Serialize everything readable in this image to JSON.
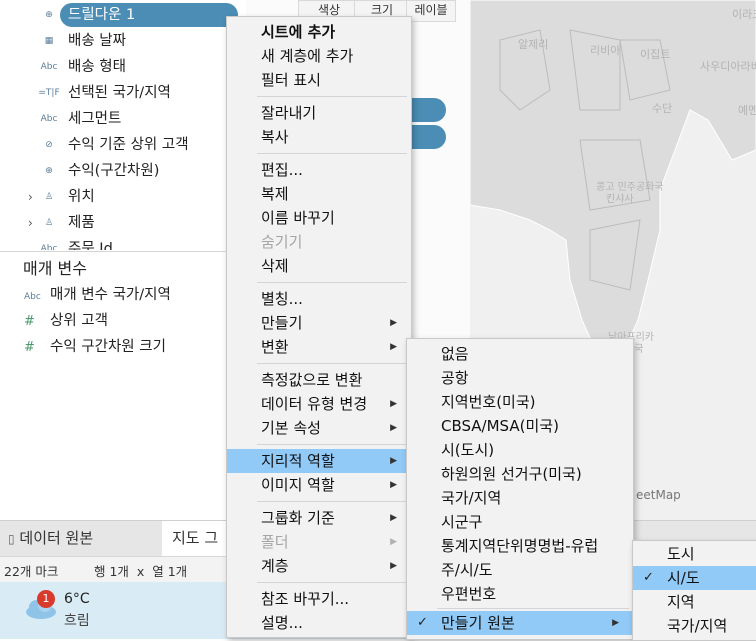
{
  "data_pane": {
    "fields": [
      {
        "icon": "⊕",
        "icon_name": "globe-icon",
        "label": "드릴다운 1",
        "selected": true
      },
      {
        "icon": "▦",
        "icon_name": "calendar-icon",
        "label": "배송 날짜"
      },
      {
        "icon": "Abc",
        "icon_name": "string-icon",
        "label": "배송 형태"
      },
      {
        "icon": "=T|F",
        "icon_name": "calculated-field-icon",
        "label": "선택된 국가/지역"
      },
      {
        "icon": "Abc",
        "icon_name": "string-icon",
        "label": "세그먼트"
      },
      {
        "icon": "⊘",
        "icon_name": "set-icon",
        "label": "수익 기준 상위 고객"
      },
      {
        "icon": "⊕",
        "icon_name": "bins-icon",
        "label": "수익(구간차원)"
      },
      {
        "icon": "♙",
        "icon_name": "hierarchy-icon",
        "label": "위치",
        "expandable": true
      },
      {
        "icon": "♙",
        "icon_name": "hierarchy-icon",
        "label": "제품",
        "expandable": true
      },
      {
        "icon": "Abc",
        "icon_name": "string-icon",
        "label": "주문 Id"
      }
    ],
    "parameters_title": "매개 변수",
    "parameters": [
      {
        "icon": "Abc",
        "icon_name": "string-icon",
        "label": "매개 변수 국가/지역"
      },
      {
        "icon": "#",
        "icon_name": "number-icon",
        "label": "상위 고객"
      },
      {
        "icon": "#",
        "icon_name": "number-icon",
        "label": "수익 구간차원 크기"
      }
    ]
  },
  "marks_card": {
    "buttons": [
      "색상",
      "크기",
      "레이블"
    ]
  },
  "map": {
    "labels": [
      "이라크",
      "알제리",
      "리비아",
      "이집트",
      "사우디아라비아",
      "수단",
      "예멘",
      "콩고 민주공화국",
      "킨샤사",
      "남아프리카",
      "공화국"
    ],
    "attribution": "eetMap"
  },
  "tabs": {
    "data_source": "데이터 원본",
    "sheet": "지도 그"
  },
  "status": {
    "marks": "22개 마크",
    "rows_cols": "행 1개  x  열 1개"
  },
  "taskbar": {
    "weather_badge": "1",
    "temperature": "6°C",
    "condition": "흐림"
  },
  "context_menu": {
    "items": [
      {
        "label": "시트에 추가",
        "bold": true
      },
      {
        "label": "새 계층에 추가"
      },
      {
        "label": "필터 표시"
      },
      {
        "separator": true
      },
      {
        "label": "잘라내기"
      },
      {
        "label": "복사"
      },
      {
        "separator": true
      },
      {
        "label": "편집..."
      },
      {
        "label": "복제"
      },
      {
        "label": "이름 바꾸기"
      },
      {
        "label": "숨기기",
        "disabled": true
      },
      {
        "label": "삭제"
      },
      {
        "separator": true
      },
      {
        "label": "별칭..."
      },
      {
        "label": "만들기",
        "submenu": true
      },
      {
        "label": "변환",
        "submenu": true
      },
      {
        "separator": true
      },
      {
        "label": "측정값으로 변환"
      },
      {
        "label": "데이터 유형 변경",
        "submenu": true
      },
      {
        "label": "기본 속성",
        "submenu": true
      },
      {
        "separator": true
      },
      {
        "label": "지리적 역할",
        "submenu": true,
        "highlighted": true
      },
      {
        "label": "이미지 역할",
        "submenu": true
      },
      {
        "separator": true
      },
      {
        "label": "그룹화 기준",
        "submenu": true
      },
      {
        "label": "폴더",
        "submenu": true,
        "disabled": true
      },
      {
        "label": "계층",
        "submenu": true
      },
      {
        "separator": true
      },
      {
        "label": "참조 바꾸기..."
      },
      {
        "label": "설명..."
      }
    ]
  },
  "geo_role_menu": {
    "items": [
      {
        "label": "없음"
      },
      {
        "label": "공항"
      },
      {
        "label": "지역번호(미국)"
      },
      {
        "label": "CBSA/MSA(미국)"
      },
      {
        "label": "시(도시)"
      },
      {
        "label": "하원의원 선거구(미국)"
      },
      {
        "label": "국가/지역"
      },
      {
        "label": "시군구"
      },
      {
        "label": "통계지역단위명명법-유럽"
      },
      {
        "label": "주/시/도"
      },
      {
        "label": "우편번호"
      },
      {
        "separator": true
      },
      {
        "label": "만들기 원본",
        "submenu": true,
        "highlighted": true,
        "checked": true
      }
    ]
  },
  "create_from_menu": {
    "items": [
      {
        "label": "도시"
      },
      {
        "label": "시/도",
        "highlighted": true,
        "checked": true
      },
      {
        "label": "지역"
      },
      {
        "label": "국가/지역"
      }
    ]
  },
  "colors": {
    "accent_pill": "#4b8db4",
    "menu_highlight": "#91c9f7",
    "menu_bg": "#f2f2f2"
  }
}
